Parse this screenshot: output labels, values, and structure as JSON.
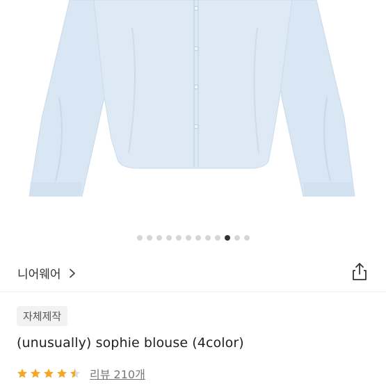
{
  "gallery": {
    "total_images": 12,
    "active_index": 9
  },
  "product": {
    "brand": "니어웨어",
    "tag": "자체제작",
    "title": "(unusually) sophie blouse (4color)",
    "rating": 4.5,
    "review_label": "리뷰 210개"
  },
  "icons": {
    "brand_link": "chevron-right-icon",
    "share": "share-icon",
    "rating": "star-icon"
  },
  "colors": {
    "star": "#f5a623",
    "blouse": "#dbe8f4",
    "active_dot": "#333333",
    "inactive_dot": "#d6d6d6"
  }
}
